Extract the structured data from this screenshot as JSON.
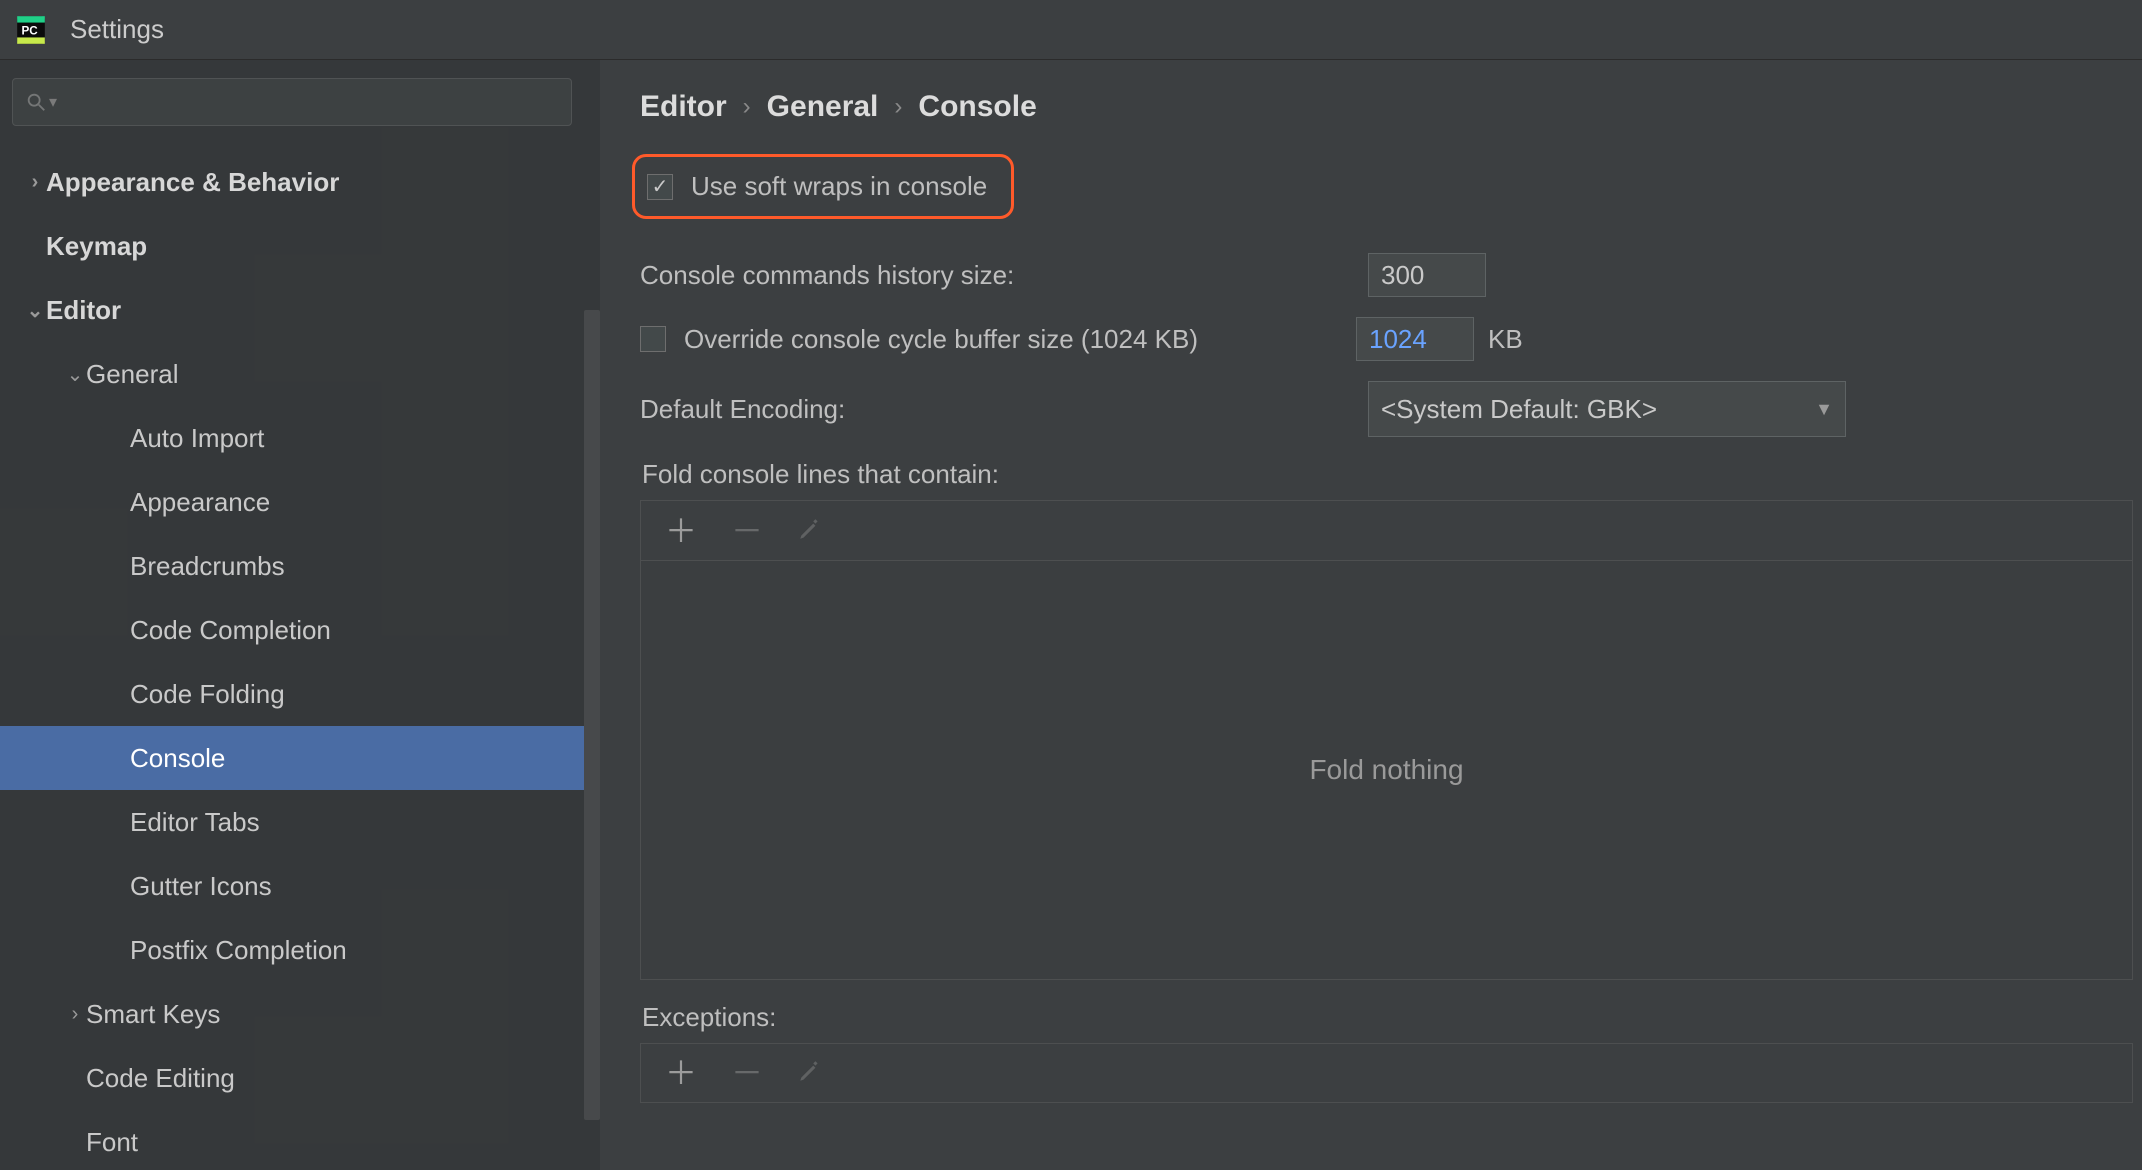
{
  "window": {
    "title": "Settings"
  },
  "sidebar": {
    "search_placeholder": "",
    "items": [
      {
        "label": "Appearance & Behavior",
        "level": 0,
        "bold": true,
        "chevron": "right"
      },
      {
        "label": "Keymap",
        "level": 0,
        "bold": true
      },
      {
        "label": "Editor",
        "level": 0,
        "bold": true,
        "chevron": "down"
      },
      {
        "label": "General",
        "level": 1,
        "chevron": "down"
      },
      {
        "label": "Auto Import",
        "level": 2
      },
      {
        "label": "Appearance",
        "level": 2
      },
      {
        "label": "Breadcrumbs",
        "level": 2
      },
      {
        "label": "Code Completion",
        "level": 2
      },
      {
        "label": "Code Folding",
        "level": 2
      },
      {
        "label": "Console",
        "level": 2,
        "selected": true
      },
      {
        "label": "Editor Tabs",
        "level": 2
      },
      {
        "label": "Gutter Icons",
        "level": 2
      },
      {
        "label": "Postfix Completion",
        "level": 2
      },
      {
        "label": "Smart Keys",
        "level": 1,
        "chevron": "right"
      },
      {
        "label": "Code Editing",
        "level": 1
      },
      {
        "label": "Font",
        "level": 1
      }
    ]
  },
  "breadcrumb": [
    "Editor",
    "General",
    "Console"
  ],
  "settings": {
    "soft_wrap": {
      "label": "Use soft wraps in console",
      "checked": true
    },
    "history": {
      "label": "Console commands history size:",
      "value": "300"
    },
    "override": {
      "label": "Override console cycle buffer size (1024 KB)",
      "checked": false,
      "value": "1024",
      "unit": "KB"
    },
    "encoding": {
      "label": "Default Encoding:",
      "value": "<System Default: GBK>"
    },
    "fold": {
      "label": "Fold console lines that contain:",
      "empty_text": "Fold nothing"
    },
    "exceptions": {
      "label": "Exceptions:"
    }
  }
}
